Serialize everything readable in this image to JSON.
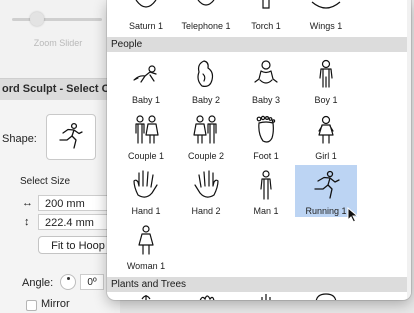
{
  "background": {
    "zoom_slider_label": "Zoom Slider",
    "window_title": "ord Sculpt - Select C",
    "shape_label": "Shape:",
    "select_size_label": "Select Size",
    "width_icon": "↔",
    "width_value": "200 mm",
    "height_icon": "↕",
    "height_value": "222.4 mm",
    "fit_button": "Fit to Hoop",
    "angle_label": "Angle:",
    "angle_value": "0º",
    "mirror_label": "Mirror"
  },
  "picker": {
    "top_row": [
      "Saturn 1",
      "Telephone 1",
      "Torch 1",
      "Wings 1"
    ],
    "sections": [
      {
        "title": "People",
        "items": [
          {
            "label": "Baby 1",
            "icon": "baby-crawling-icon"
          },
          {
            "label": "Baby 2",
            "icon": "baby-curled-icon"
          },
          {
            "label": "Baby 3",
            "icon": "baby-sitting-icon"
          },
          {
            "label": "Boy 1",
            "icon": "boy-icon"
          },
          {
            "label": "Couple 1",
            "icon": "couple-1-icon"
          },
          {
            "label": "Couple 2",
            "icon": "couple-2-icon"
          },
          {
            "label": "Foot 1",
            "icon": "foot-icon"
          },
          {
            "label": "Girl 1",
            "icon": "girl-icon"
          },
          {
            "label": "Hand 1",
            "icon": "hand-1-icon"
          },
          {
            "label": "Hand 2",
            "icon": "hand-2-icon"
          },
          {
            "label": "Man 1",
            "icon": "man-icon"
          },
          {
            "label": "Running 1",
            "icon": "running-person-icon",
            "selected": true
          },
          {
            "label": "Woman 1",
            "icon": "woman-icon"
          }
        ]
      },
      {
        "title": "Plants and Trees",
        "items": []
      }
    ],
    "selection_color": "#bcd4f3"
  }
}
